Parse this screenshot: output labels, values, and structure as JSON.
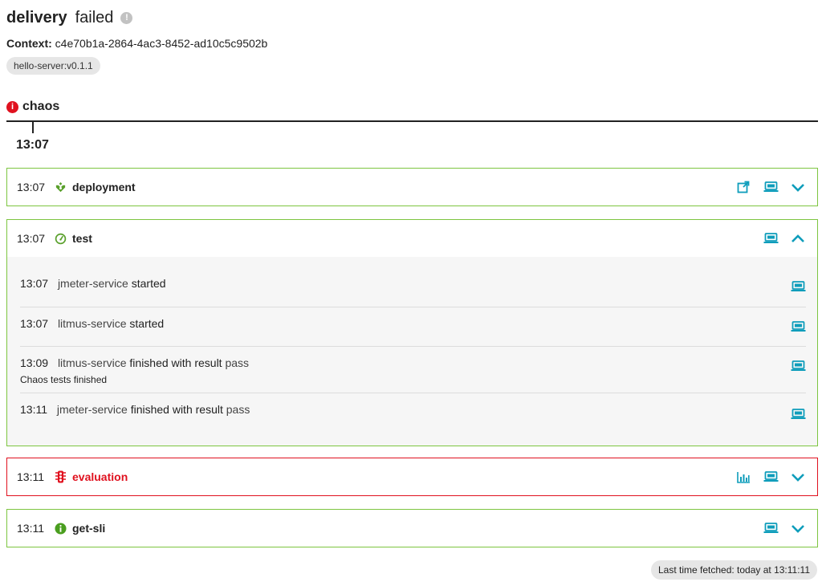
{
  "header": {
    "title": "delivery",
    "status": "failed",
    "context_label": "Context:",
    "context_value": "c4e70b1a-2864-4ac3-8452-ad10c5c9502b",
    "tag": "hello-server:v0.1.1"
  },
  "stage": {
    "name": "chaos",
    "time": "13:07"
  },
  "cards": {
    "deployment": {
      "time": "13:07",
      "title": "deployment"
    },
    "test": {
      "time": "13:07",
      "title": "test",
      "events": [
        {
          "time": "13:07",
          "source": "jmeter-service",
          "text": "started",
          "sub": ""
        },
        {
          "time": "13:07",
          "source": "litmus-service",
          "text": "started",
          "sub": ""
        },
        {
          "time": "13:09",
          "source": "litmus-service",
          "text": "finished with result",
          "result": "pass",
          "sub": "Chaos tests finished"
        },
        {
          "time": "13:11",
          "source": "jmeter-service",
          "text": "finished with result",
          "result": "pass",
          "sub": ""
        }
      ]
    },
    "evaluation": {
      "time": "13:11",
      "title": "evaluation"
    },
    "getsli": {
      "time": "13:11",
      "title": "get-sli"
    }
  },
  "footer": {
    "last_fetched": "Last time fetched: today at 13:11:11"
  },
  "colors": {
    "success": "#7dc540",
    "error": "#e0111f",
    "accent": "#0e9dbb"
  },
  "icons": {
    "deploy": "deploy-icon",
    "test": "speedometer-icon",
    "evaluation": "traffic-light-icon",
    "getsli": "info-icon",
    "external": "external-link-icon",
    "payload": "laptop-icon",
    "chart": "chart-icon",
    "expand": "chevron-down-icon",
    "collapse": "chevron-up-icon"
  }
}
